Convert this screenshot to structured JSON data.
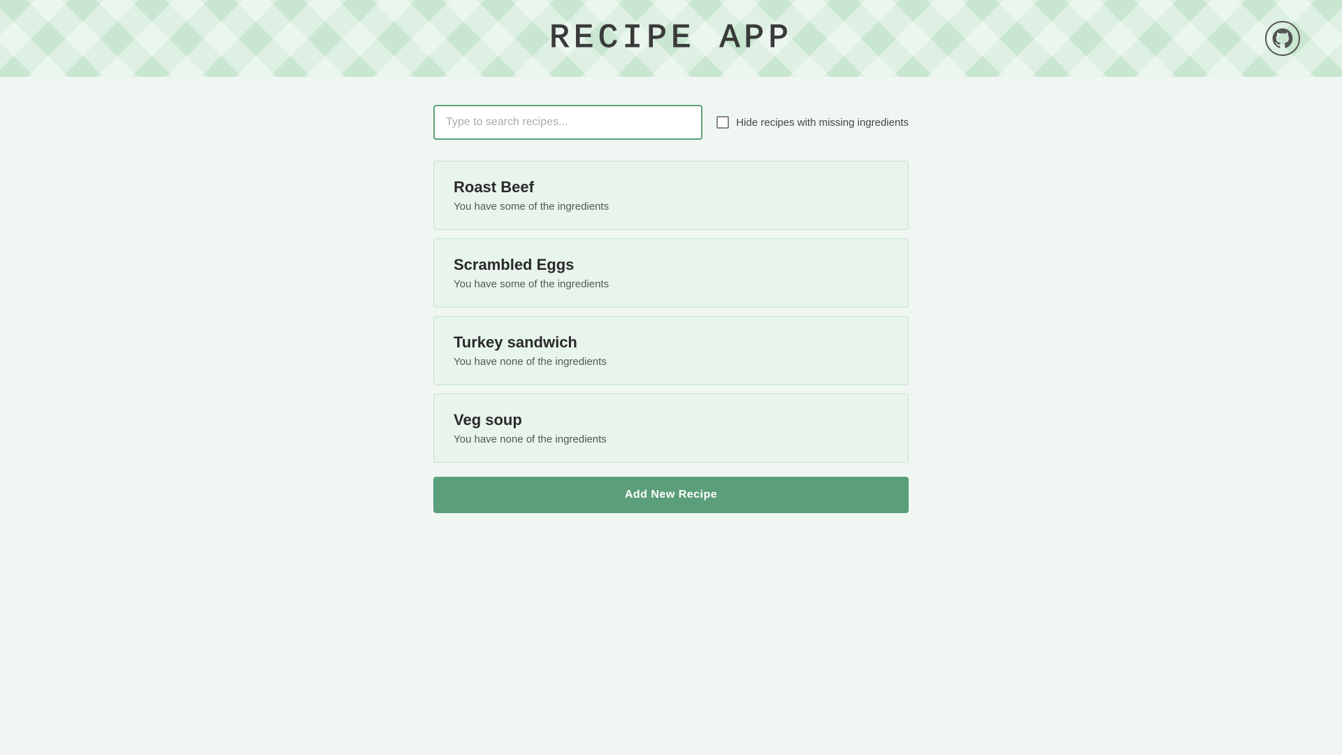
{
  "header": {
    "title": "RECIPE APP",
    "github_label": "GitHub"
  },
  "search": {
    "placeholder": "Type to search recipes...",
    "value": ""
  },
  "hide_missing": {
    "label": "Hide recipes with missing ingredients",
    "checked": false
  },
  "recipes": [
    {
      "id": 1,
      "name": "Roast Beef",
      "ingredient_status": "You have some of the ingredients"
    },
    {
      "id": 2,
      "name": "Scrambled Eggs",
      "ingredient_status": "You have some of the ingredients"
    },
    {
      "id": 3,
      "name": "Turkey sandwich",
      "ingredient_status": "You have none of the ingredients"
    },
    {
      "id": 4,
      "name": "Veg soup",
      "ingredient_status": "You have none of the ingredients"
    }
  ],
  "add_recipe_button": {
    "label": "Add New Recipe"
  }
}
